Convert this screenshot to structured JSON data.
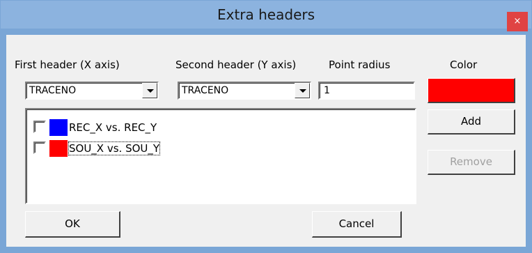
{
  "window": {
    "title": "Extra headers",
    "close_glyph": "×"
  },
  "labels": {
    "first_header": "First header (X axis)",
    "second_header": "Second header (Y axis)",
    "point_radius": "Point radius",
    "color": "Color"
  },
  "first_header_select": {
    "value": "TRACENO"
  },
  "second_header_select": {
    "value": "TRACENO"
  },
  "point_radius_input": {
    "value": "1"
  },
  "color_button": {
    "color": "#ff0000"
  },
  "buttons": {
    "add": "Add",
    "remove": "Remove",
    "ok": "OK",
    "cancel": "Cancel"
  },
  "list": {
    "items": [
      {
        "label": "REC_X vs. REC_Y",
        "color": "#0000ff",
        "checked": false
      },
      {
        "label": "SOU_X vs. SOU_Y",
        "color": "#ff0000",
        "checked": false
      }
    ]
  },
  "icons": {
    "close": "close-icon",
    "dropdown": "chevron-down-icon"
  }
}
